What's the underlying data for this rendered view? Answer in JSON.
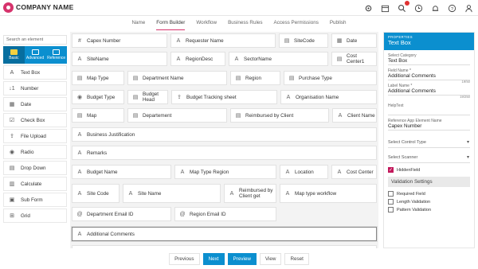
{
  "header": {
    "company": "COMPANY NAME",
    "icons": [
      "gear-icon",
      "calendar-icon",
      "search-icon",
      "clock-icon",
      "bell-icon",
      "help-icon",
      "user-icon"
    ]
  },
  "tabs": [
    {
      "label": "Name"
    },
    {
      "label": "Form Builder",
      "active": true
    },
    {
      "label": "Workflow"
    },
    {
      "label": "Business Rules"
    },
    {
      "label": "Access Permissions"
    },
    {
      "label": "Publish"
    }
  ],
  "sidebar": {
    "search_placeholder": "Search an element",
    "modes": [
      {
        "label": "Basic"
      },
      {
        "label": "Advanced"
      },
      {
        "label": "Reference"
      }
    ],
    "items": [
      {
        "label": "Text Box",
        "icon": "text-icon"
      },
      {
        "label": "Number",
        "icon": "number-icon"
      },
      {
        "label": "Date",
        "icon": "date-icon"
      },
      {
        "label": "Check Box",
        "icon": "checkbox-icon"
      },
      {
        "label": "File Upload",
        "icon": "upload-icon"
      },
      {
        "label": "Radio",
        "icon": "radio-icon"
      },
      {
        "label": "Drop Down",
        "icon": "dropdown-icon"
      },
      {
        "label": "Calculate",
        "icon": "calculate-icon"
      },
      {
        "label": "Sub Form",
        "icon": "subform-icon"
      },
      {
        "label": "Grid",
        "icon": "grid-icon"
      }
    ]
  },
  "canvas": {
    "fields": [
      "Capex Number",
      "Requester Name",
      "SiteCode",
      "Date",
      "SiteName",
      "RegionDesc",
      "SectorName",
      "Cost Center1",
      "Map Type",
      "Department Name",
      "Region",
      "Purchase Type",
      "Budget Type",
      "Budget Head",
      "Budget Tracking sheet",
      "Organisation Name",
      "Map",
      "Departement",
      "Reimbursed by Client",
      "Client Name",
      "Business Justification",
      "Remarks",
      "Budget Name",
      "Map Type Region",
      "Location",
      "Cost Center",
      "Site Code",
      "Site Name",
      "Reimbursed by Client get",
      "Map type workflow",
      "Department Email ID",
      "Region Email ID",
      "Additional Comments"
    ]
  },
  "properties": {
    "small_title": "PROPERTIES",
    "title": "Text Box",
    "select_category_label": "Select Category",
    "select_category_value": "Text Box",
    "field_name_label": "Field Name *",
    "field_name_value": "Additional Comments",
    "field_name_count": "19/50",
    "label_name_label": "Label Name *",
    "label_name_value": "Additional Comments",
    "label_name_count": "19/250",
    "helptext_label": "HelpText",
    "reference_label": "Reference App Element Name",
    "reference_value": "Capex Number",
    "control_type": "Select Control Type",
    "scanner": "Select Scanner",
    "hidden_field": "HiddenField",
    "validation_heading": "Validation Settings",
    "required": "Required Field",
    "length": "Length Validation",
    "pattern": "Pattern Validation"
  },
  "footer": {
    "previous": "Previous",
    "next": "Next",
    "preview": "Preview",
    "view": "View",
    "reset": "Reset"
  },
  "colors": {
    "accent": "#0b8fcf",
    "brand": "#d6336c",
    "check": "#c2185b"
  }
}
